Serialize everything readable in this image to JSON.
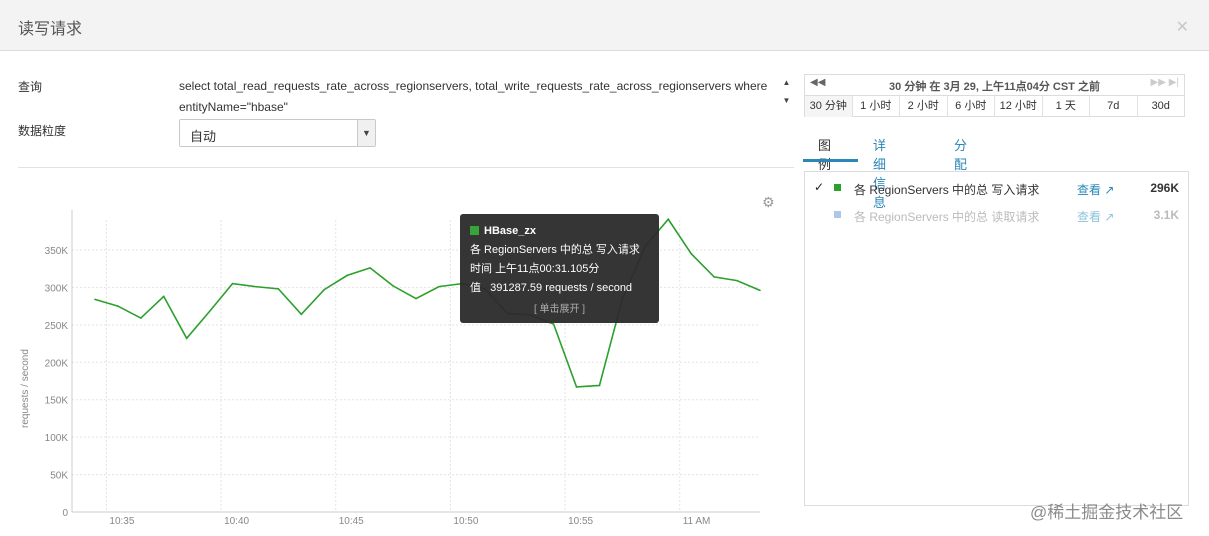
{
  "dialog": {
    "title": "读写请求",
    "close_icon": "close-icon"
  },
  "query": {
    "label": "查询",
    "text": "select total_read_requests_rate_across_regionservers, total_write_requests_rate_across_regionservers where entityName=\"hbase\""
  },
  "granularity": {
    "label": "数据粒度",
    "value": "自动"
  },
  "time_nav": {
    "range_label": "30 分钟 在 3月 29, 上午11点04分 CST 之前",
    "buttons": [
      "30 分钟",
      "1 小时",
      "2 小时",
      "6 小时",
      "12 小时",
      "1 天",
      "7d",
      "30d"
    ]
  },
  "tabs": [
    "图例",
    "详细信息",
    "分配"
  ],
  "legend": [
    {
      "check": "✓",
      "name": "各 RegionServers 中的总 写入请求",
      "link": "查看",
      "value": "296K",
      "color": "#2ca02c"
    },
    {
      "check": "",
      "name": "各 RegionServers 中的总 读取请求",
      "link": "查看",
      "value": "3.1K",
      "color": "#aec7e8"
    }
  ],
  "tooltip": {
    "series": "HBase_zx",
    "metric": "各 RegionServers 中的总 写入请求",
    "time_label": "时间",
    "time_value": "上午11点00:31.105分",
    "value_label": "值",
    "value": "391287.59 requests / second",
    "expand": "[ 单击展开 ]"
  },
  "chart_data": {
    "type": "line",
    "ylabel": "requests / second",
    "y_ticks": [
      "0",
      "50K",
      "100K",
      "150K",
      "200K",
      "250K",
      "300K",
      "350K"
    ],
    "x_ticks": [
      "10:35",
      "10:40",
      "10:45",
      "10:50",
      "10:55",
      "11 AM"
    ],
    "ylim": [
      0,
      390000
    ],
    "series": [
      {
        "name": "各 RegionServers 中的总 写入请求",
        "color": "#2ca02c",
        "x": [
          34.5,
          35.5,
          36.5,
          37.5,
          38.5,
          39.5,
          40.5,
          41.5,
          42.5,
          43.5,
          44.5,
          45.5,
          46.5,
          47.5,
          48.5,
          49.5,
          50.5,
          51.5,
          52.5,
          53.5,
          54.5,
          55.5,
          56.5,
          57.5,
          58.5,
          59.5,
          60.5,
          61.5,
          62.5,
          63.5
        ],
        "values": [
          284000,
          275000,
          259000,
          288000,
          232000,
          268000,
          305000,
          301000,
          298000,
          264000,
          297000,
          316000,
          326000,
          302000,
          285000,
          301000,
          305000,
          298000,
          265000,
          263000,
          251000,
          167000,
          169000,
          285000,
          355000,
          391000,
          345000,
          314000,
          309000,
          296000
        ]
      }
    ]
  },
  "watermark": "@稀土掘金技术社区"
}
